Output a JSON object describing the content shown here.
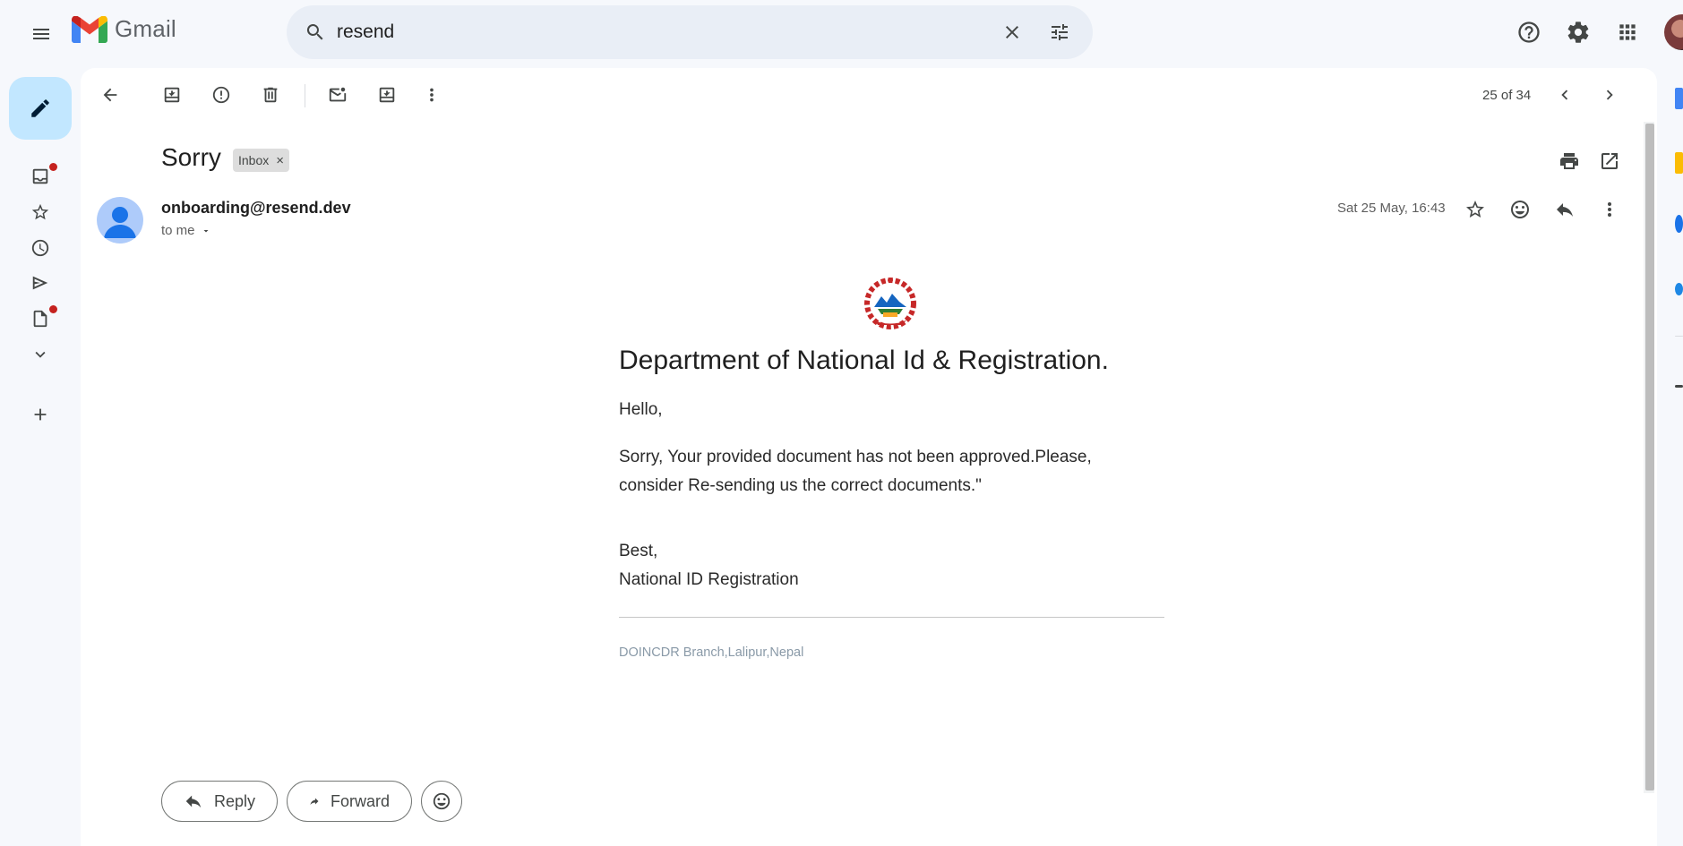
{
  "header": {
    "app_name": "Gmail",
    "search_value": "resend"
  },
  "toolbar": {
    "pager": "25 of 34"
  },
  "email": {
    "subject": "Sorry",
    "label": "Inbox",
    "label_remove": "×",
    "sender": "onboarding@resend.dev",
    "recipient": "to me",
    "date": "Sat 25 May, 16:43"
  },
  "body": {
    "title": "Department of National Id & Registration.",
    "greeting": "Hello,",
    "message_line1": "Sorry, Your provided document has not been approved.Please,",
    "message_line2": "consider Re-sending us the correct documents.\"",
    "signoff": "Best,",
    "signature": "National ID Registration",
    "footer": "DOINCDR Branch,Lalipur,Nepal"
  },
  "actions": {
    "reply": "Reply",
    "forward": "Forward"
  },
  "colors": {
    "accent": "#c2e7ff",
    "notification_dot": "#c5221f",
    "background": "#f6f8fc"
  },
  "icons": [
    "menu-icon",
    "gmail-logo-icon",
    "search-icon",
    "clear-icon",
    "search-options-icon",
    "help-icon",
    "settings-icon",
    "apps-icon",
    "compose-pencil-icon",
    "inbox-icon",
    "star-icon",
    "clock-icon",
    "send-icon",
    "draft-icon",
    "chevron-down-icon",
    "plus-icon",
    "back-arrow-icon",
    "archive-icon",
    "report-spam-icon",
    "delete-icon",
    "mark-unread-icon",
    "move-to-icon",
    "more-vert-icon",
    "prev-icon",
    "next-icon",
    "print-icon",
    "open-new-window-icon",
    "emoji-icon",
    "reply-icon",
    "forward-icon"
  ]
}
